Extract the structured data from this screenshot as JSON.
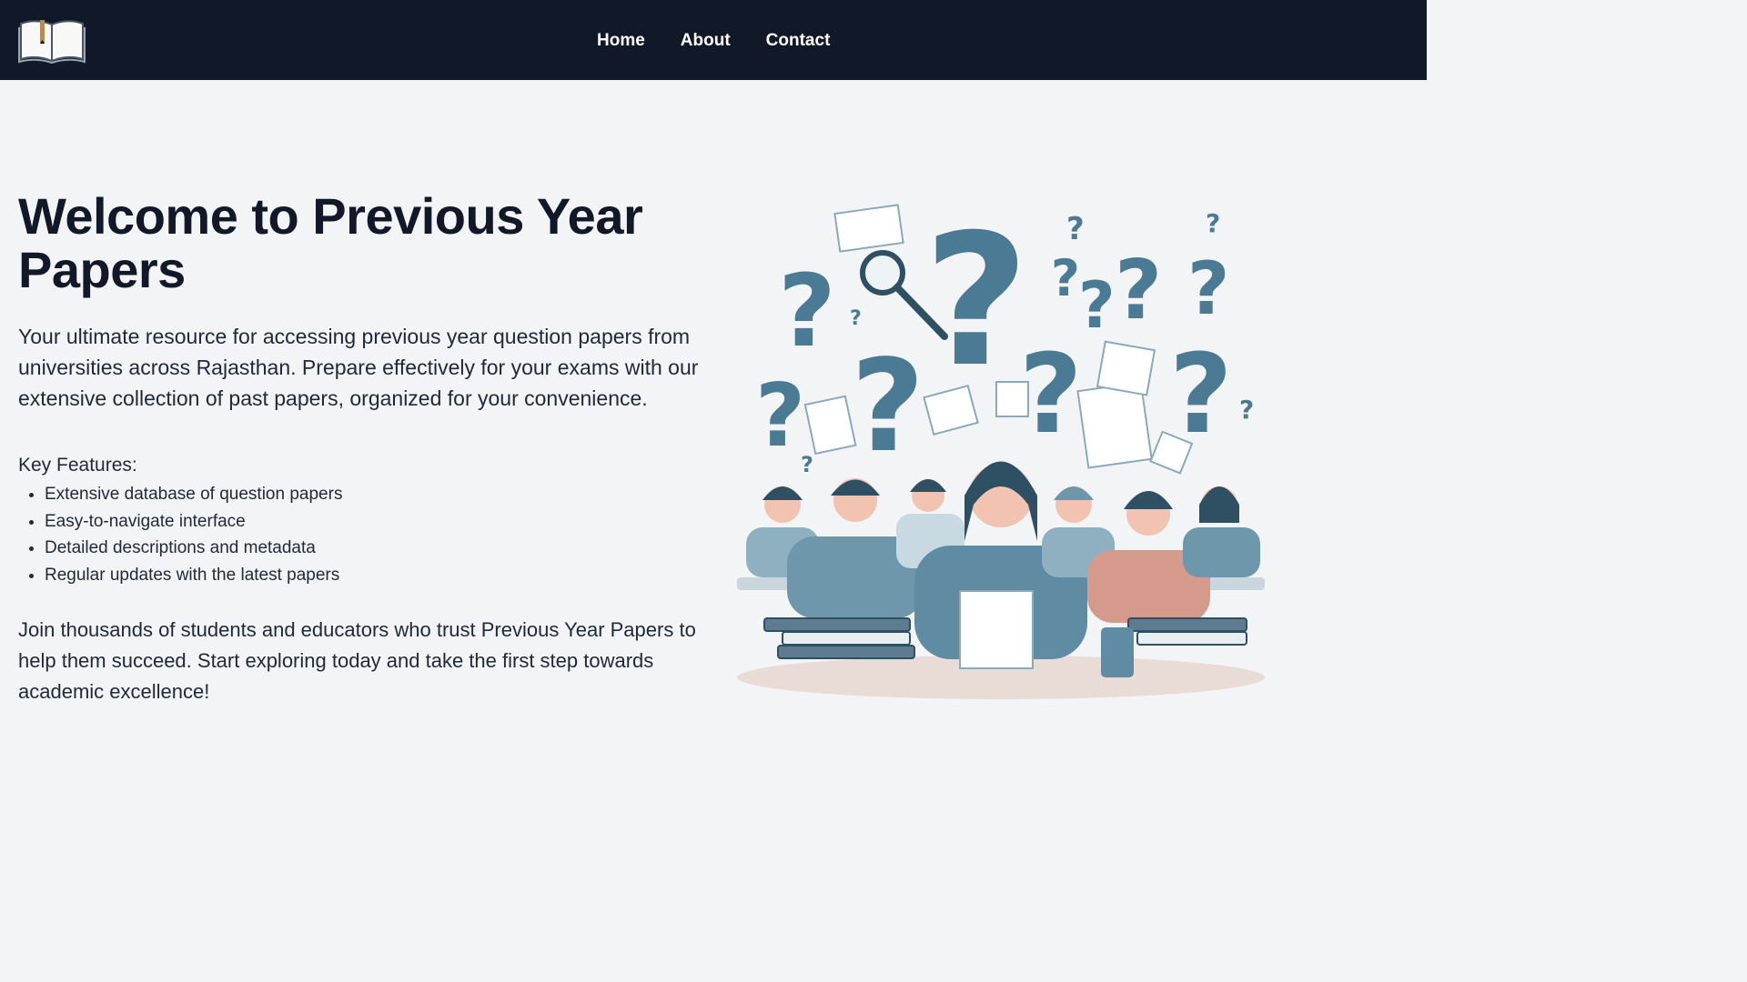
{
  "nav": {
    "logo_icon": "open-book-icon",
    "links": [
      "Home",
      "About",
      "Contact"
    ]
  },
  "hero": {
    "title": "Welcome to Previous Year Papers",
    "intro": "Your ultimate resource for accessing previous year question papers from universities across Rajasthan. Prepare effectively for your exams with our extensive collection of past papers, organized for your convenience.",
    "features_title": "Key Features:",
    "features": [
      "Extensive database of question papers",
      "Easy-to-navigate interface",
      "Detailed descriptions and metadata",
      "Regular updates with the latest papers"
    ],
    "outro": "Join thousands of students and educators who trust Previous Year Papers to help them succeed. Start exploring today and take the first step towards academic excellence!",
    "illustration_icon": "students-studying-with-question-marks-illustration"
  },
  "colors": {
    "navbar_bg": "#111827",
    "page_bg": "#f3f4f6",
    "accent": "#4b7a94"
  }
}
